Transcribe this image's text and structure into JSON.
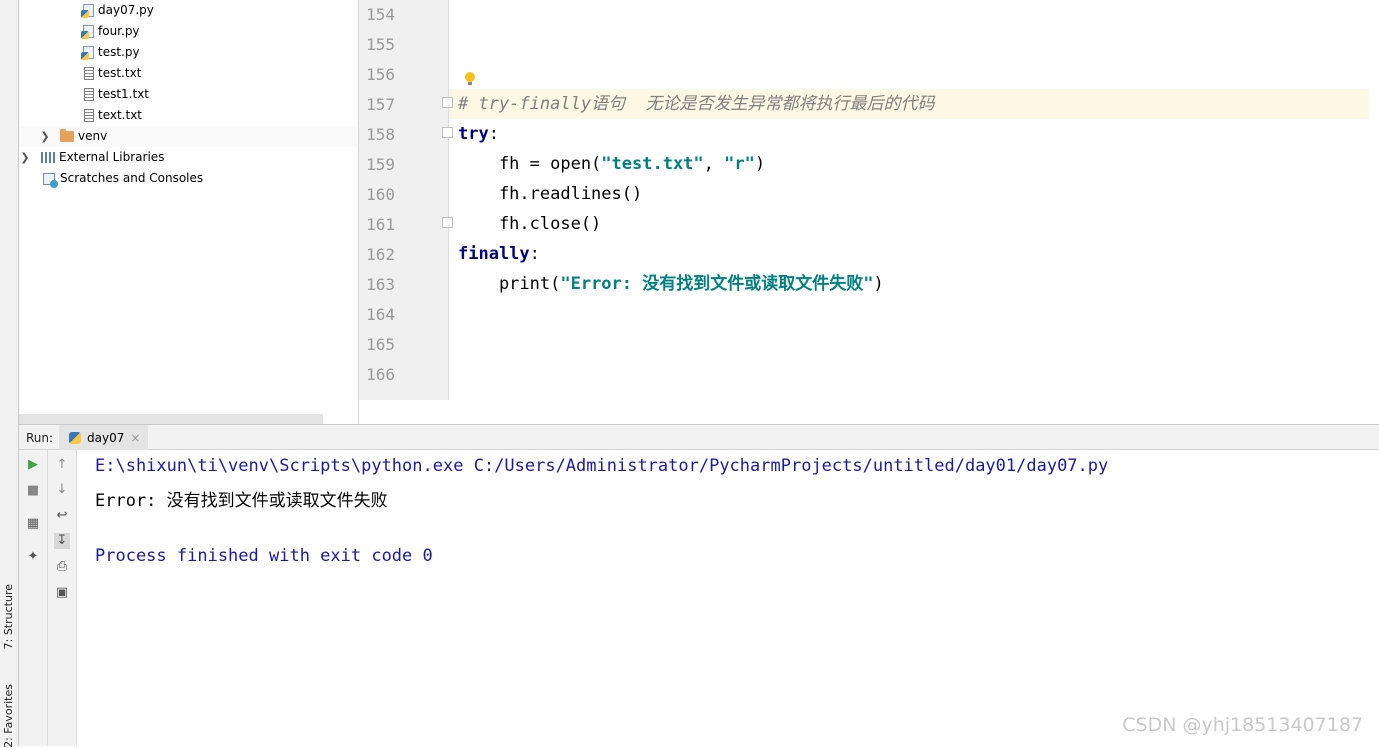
{
  "left_stripe": {
    "structure_tab": "7: Structure",
    "favorites_tab": "2: Favorites"
  },
  "project_tree": {
    "items": [
      {
        "label": "day07.py",
        "icon": "python-file-icon"
      },
      {
        "label": "four.py",
        "icon": "python-file-icon"
      },
      {
        "label": "test.py",
        "icon": "python-file-icon"
      },
      {
        "label": "test.txt",
        "icon": "text-file-icon"
      },
      {
        "label": "test1.txt",
        "icon": "text-file-icon"
      },
      {
        "label": "text.txt",
        "icon": "text-file-icon"
      },
      {
        "label": "venv",
        "icon": "folder-icon",
        "collapsed": true
      },
      {
        "label": "External Libraries",
        "icon": "library-icon",
        "collapsed": true
      },
      {
        "label": "Scratches and Consoles",
        "icon": "scratches-icon"
      }
    ]
  },
  "editor": {
    "line_numbers": [
      "154",
      "155",
      "156",
      "157",
      "158",
      "159",
      "160",
      "161",
      "162",
      "163",
      "164",
      "165",
      "166"
    ],
    "current_line": "157",
    "code": {
      "comment": "# try-finally语句  无论是否发生异常都将执行最后的代码",
      "try_kw": "try",
      "colon": ":",
      "l159_a": "    fh = open(",
      "l159_s1": "\"test.txt\"",
      "l159_comma": ", ",
      "l159_s2": "\"r\"",
      "l159_close": ")",
      "l160": "    fh.readlines()",
      "l161": "    fh.close()",
      "finally_kw": "finally",
      "l163_a": "    print(",
      "l163_s": "\"Error: 没有找到文件或读取文件失败\"",
      "l163_close": ")"
    }
  },
  "run_panel": {
    "label": "Run:",
    "tab_label": "day07",
    "console_lines": [
      "E:\\shixun\\ti\\venv\\Scripts\\python.exe C:/Users/Administrator/PycharmProjects/untitled/day01/day07.py",
      "Error: 没有找到文件或读取文件失败",
      "",
      "Process finished with exit code 0"
    ]
  },
  "watermark": "CSDN @yhj18513407187",
  "colors": {
    "keyword": "#000080",
    "string": "#008080",
    "comment": "#808080",
    "console_blue": "#1a1aa6",
    "current_line_bg": "#fcf8e3"
  }
}
